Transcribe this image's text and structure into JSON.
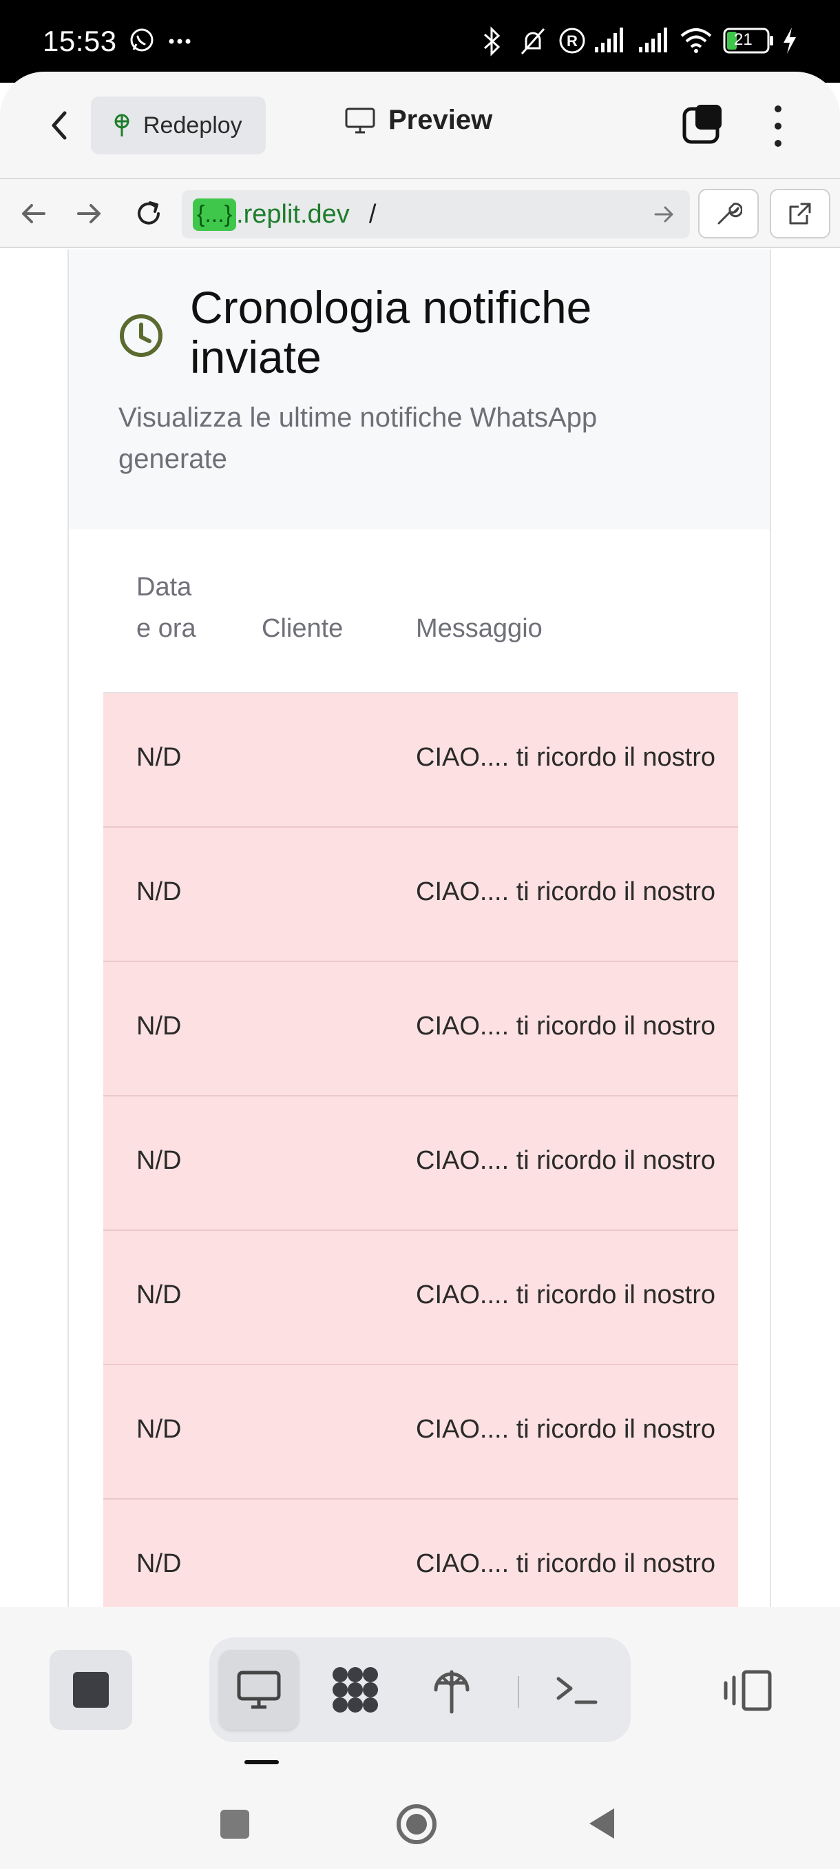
{
  "status_bar": {
    "time": "15:53",
    "battery": "21"
  },
  "header": {
    "redeploy_label": "Redeploy",
    "preview_label": "Preview"
  },
  "url_bar": {
    "chip": "{...}",
    "domain": ".replit.dev",
    "path": "/"
  },
  "card": {
    "title": "Cronologia notifiche inviate",
    "subtitle": "Visualizza le ultime notifiche WhatsApp generate"
  },
  "table": {
    "headers": {
      "date": "Data e ora",
      "client": "Cliente",
      "message": "Messaggio"
    },
    "rows": [
      {
        "date": "N/D",
        "client": "",
        "message": "CIAO.... ti ricordo il nostro"
      },
      {
        "date": "N/D",
        "client": "",
        "message": "CIAO.... ti ricordo il nostro"
      },
      {
        "date": "N/D",
        "client": "",
        "message": "CIAO.... ti ricordo il nostro"
      },
      {
        "date": "N/D",
        "client": "",
        "message": "CIAO.... ti ricordo il nostro"
      },
      {
        "date": "N/D",
        "client": "",
        "message": "CIAO.... ti ricordo il nostro"
      },
      {
        "date": "N/D",
        "client": "",
        "message": "CIAO.... ti ricordo il nostro"
      },
      {
        "date": "N/D",
        "client": "",
        "message": "CIAO.... ti ricordo il nostro"
      }
    ],
    "row_color": "#fde0e1"
  },
  "colors": {
    "accent_green": "#3ec74a",
    "icon_olive": "#5b6b2f"
  }
}
